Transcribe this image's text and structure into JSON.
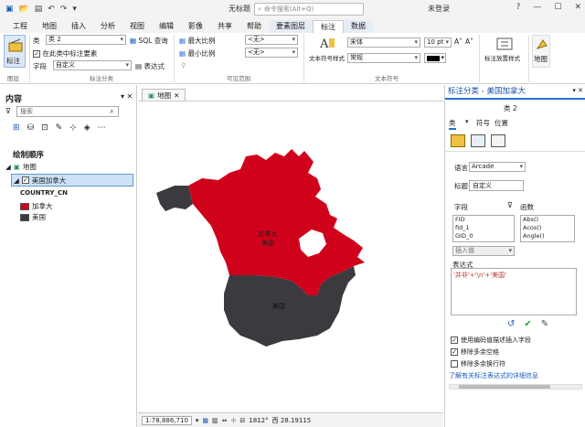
{
  "titlebar": {
    "title": "无标题",
    "search_placeholder": "命令搜索(Alt+Q)",
    "user": "未登录",
    "help": "?"
  },
  "tabs": [
    "工程",
    "地图",
    "插入",
    "分析",
    "视图",
    "编辑",
    "影像",
    "共享",
    "帮助",
    "要素图层",
    "标注",
    "数据"
  ],
  "ribbon": {
    "label_btn": "标注",
    "layers_group": "图层",
    "class_label": "类",
    "class_value": "类 2",
    "sql_label": "SQL 查询",
    "label_in_class": "在此类中标注要素",
    "field_label": "字段",
    "field_value": "自定义",
    "expression_label": "表达式",
    "label_class_group": "标注分类",
    "max_scale": "最大比例",
    "min_scale": "最小比例",
    "max_scale_value": "<无>",
    "min_scale_value": "<无>",
    "visible_range_group": "可见范围",
    "text_symbol_style": "文本符号样式",
    "font_value": "宋体",
    "font_size": "10 pt",
    "font_style": "常规",
    "text_symbol_group": "文本符号",
    "placement_style": "标注放置样式",
    "map_btn": "地图"
  },
  "contents": {
    "title": "内容",
    "search_placeholder": "搜索",
    "draw_order": "绘制顺序",
    "map_item": "地图",
    "layer_item": "美国加拿大",
    "field_name": "COUNTRY_CN",
    "classes": [
      {
        "label": "加拿大",
        "color": "#d0021b"
      },
      {
        "label": "美国",
        "color": "#3c3a3e"
      }
    ]
  },
  "map": {
    "tab_label": "地图",
    "label_canada": "加拿大",
    "label_canada_2": "美国",
    "label_usa": "美国",
    "canada_color": "#d0021b",
    "usa_color": "#3c3a3e",
    "scale": "1:78,886,710",
    "rotation": "1812°",
    "coords": "西 28.19115"
  },
  "label_pane": {
    "title": "标注分类 - 美国加拿大",
    "class_value": "类 2",
    "tab_class": "类",
    "tab_symbol": "符号",
    "tab_position": "位置",
    "language_label": "语言",
    "language_value": "Arcade",
    "title_label": "标题",
    "title_value": "自定义",
    "fields_label": "字段",
    "functions_label": "函数",
    "fields": [
      "FID",
      "fid_1",
      "GID_0"
    ],
    "functions": [
      "Abs()",
      "Acos()",
      "Angle()"
    ],
    "insert_value": "插入值",
    "expression_label": "表达式",
    "expression": "'并非'+'\\n'+'美国'",
    "opt1": "使用编码值描述插入字段",
    "opt2": "移除多余空格",
    "opt3": "移除多余换行符",
    "help_link": "了解有关标注表达式的详细信息"
  }
}
